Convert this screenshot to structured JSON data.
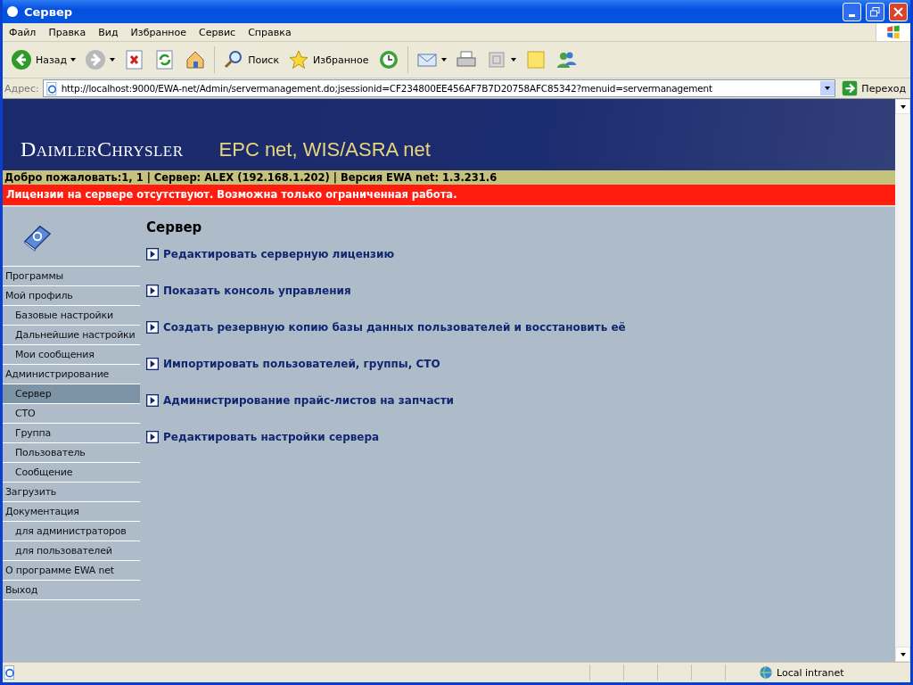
{
  "window": {
    "title": "Сервер"
  },
  "menu": [
    "Файл",
    "Правка",
    "Вид",
    "Избранное",
    "Сервис",
    "Справка"
  ],
  "toolbar": [
    {
      "kind": "back",
      "label": "Назад"
    },
    {
      "kind": "forward"
    },
    {
      "kind": "stop"
    },
    {
      "kind": "refresh"
    },
    {
      "kind": "home"
    },
    {
      "kind": "search",
      "label": "Поиск"
    },
    {
      "kind": "favorites",
      "label": "Избранное"
    },
    {
      "kind": "history"
    },
    {
      "kind": "mail"
    },
    {
      "kind": "print"
    },
    {
      "kind": "edit"
    },
    {
      "kind": "notes"
    },
    {
      "kind": "messenger"
    }
  ],
  "address": {
    "label": "Адрес:",
    "url": "http://localhost:9000/EWA-net/Admin/servermanagement.do;jsessionid=CF234800EE456AF7B7D20758AFC85342?menuid=servermanagement",
    "go": "Переход"
  },
  "banner": {
    "logo": "DaimlerChrysler",
    "product": "EPC net, WIS/ASRA net"
  },
  "info_bar": "Добро пожаловать:1, 1 | Сервер: ALEX (192.168.1.202) | Версия EWA net: 1.3.231.6",
  "warning_bar": "Лицензии на сервере отсутствуют. Возможна только ограниченная работа.",
  "sidebar": {
    "items": [
      {
        "label": "Программы",
        "selected": false
      },
      {
        "label": "Мой профиль",
        "selected": false,
        "children": [
          {
            "label": "Базовые настройки",
            "selected": false
          },
          {
            "label": "Дальнейшие настройки",
            "selected": false
          },
          {
            "label": "Мои сообщения",
            "selected": false
          }
        ]
      },
      {
        "label": "Администрирование",
        "selected": false,
        "children": [
          {
            "label": "Сервер",
            "selected": true
          },
          {
            "label": "СТО",
            "selected": false
          },
          {
            "label": "Группа",
            "selected": false
          },
          {
            "label": "Пользователь",
            "selected": false
          },
          {
            "label": "Сообщение",
            "selected": false
          }
        ]
      },
      {
        "label": "Загрузить",
        "selected": false
      },
      {
        "label": "Документация",
        "selected": false,
        "children": [
          {
            "label": "для администраторов",
            "selected": false
          },
          {
            "label": "для пользователей",
            "selected": false
          }
        ]
      },
      {
        "label": "О программе EWA net",
        "selected": false
      },
      {
        "label": "Выход",
        "selected": false
      }
    ]
  },
  "content": {
    "title": "Сервер",
    "links": [
      "Редактировать серверную лицензию",
      "Показать консоль управления",
      "Создать резервную копию базы данных пользователей и восстановить её",
      "Импортировать пользователей, группы, СТО",
      "Администрирование прайс-листов на запчасти",
      "Редактировать настройки сервера"
    ]
  },
  "status_bar": {
    "zone": "Local intranet"
  }
}
